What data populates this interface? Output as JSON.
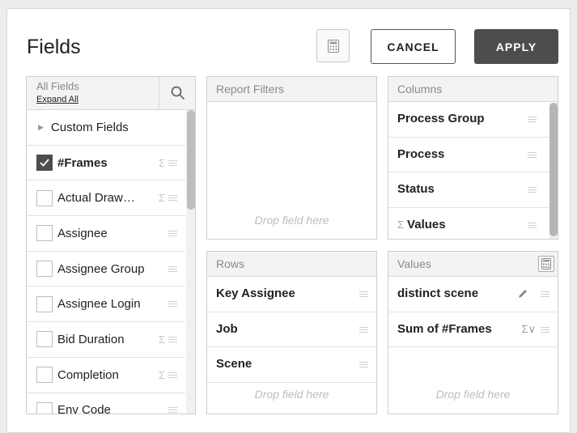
{
  "dialog": {
    "title": "Fields",
    "calculator_icon": "calculator-icon",
    "cancel_label": "CANCEL",
    "apply_label": "APPLY"
  },
  "fields_list": {
    "header_label": "All Fields",
    "expand_all": "Expand All",
    "search_icon": "search-icon",
    "custom_group": "Custom Fields",
    "items": [
      {
        "label": "#Frames",
        "checked": true,
        "sigma": true
      },
      {
        "label": "Actual Draw…",
        "checked": false,
        "sigma": true
      },
      {
        "label": "Assignee",
        "checked": false,
        "sigma": false
      },
      {
        "label": "Assignee Group",
        "checked": false,
        "sigma": false
      },
      {
        "label": "Assignee Login",
        "checked": false,
        "sigma": false
      },
      {
        "label": "Bid Duration",
        "checked": false,
        "sigma": true
      },
      {
        "label": "Completion",
        "checked": false,
        "sigma": true
      },
      {
        "label": "Env Code",
        "checked": false,
        "sigma": false
      }
    ]
  },
  "report_filters": {
    "header": "Report Filters",
    "drop_hint": "Drop field here"
  },
  "columns": {
    "header": "Columns",
    "items": [
      "Process Group",
      "Process",
      "Status",
      "Values"
    ]
  },
  "rows": {
    "header": "Rows",
    "items": [
      "Key Assignee",
      "Job",
      "Scene"
    ],
    "drop_hint": "Drop field here"
  },
  "values": {
    "header": "Values",
    "items": [
      "distinct scene",
      "Sum of #Frames"
    ],
    "drop_hint": "Drop field here"
  }
}
